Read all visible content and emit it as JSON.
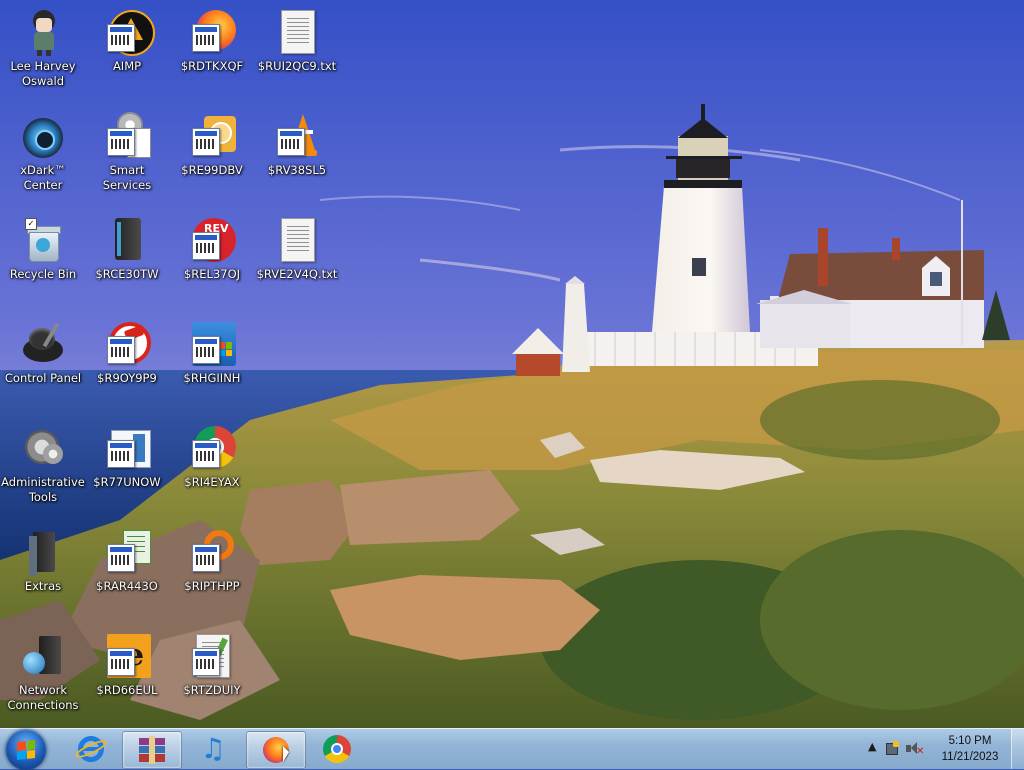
{
  "desktop": {
    "icons": [
      {
        "label": "Lee Harvey Oswald",
        "icon": "person-figure-icon"
      },
      {
        "label": "AIMP",
        "icon": "aimp-icon"
      },
      {
        "label": "$RDTKXQF",
        "icon": "firefox-shortcut-icon"
      },
      {
        "label": "$RUI2QC9.txt",
        "icon": "text-document-icon"
      },
      {
        "label": "xDark™ Center",
        "icon": "xdark-center-icon"
      },
      {
        "label": "Smart Services",
        "icon": "smart-services-icon"
      },
      {
        "label": "$RE99DBV",
        "icon": "shortcut-icon"
      },
      {
        "label": "$RV38SL5",
        "icon": "vlc-shortcut-icon"
      },
      {
        "label": "Recycle Bin",
        "icon": "recycle-bin-icon"
      },
      {
        "label": "$RCE30TW",
        "icon": "dark-device-icon"
      },
      {
        "label": "$REL37OJ",
        "icon": "rev-shortcut-icon"
      },
      {
        "label": "$RVE2V4Q.txt",
        "icon": "text-document-icon"
      },
      {
        "label": "Control Panel",
        "icon": "control-panel-icon"
      },
      {
        "label": "$R9OY9P9",
        "icon": "ccleaner-shortcut-icon"
      },
      {
        "label": "$RHGIINH",
        "icon": "installer-shortcut-icon"
      },
      {
        "label": "Administrative Tools",
        "icon": "administrative-tools-icon"
      },
      {
        "label": "$R77UNOW",
        "icon": "window-shortcut-icon"
      },
      {
        "label": "$RI4EYAX",
        "icon": "chrome-shortcut-icon"
      },
      {
        "label": "Extras",
        "icon": "extras-icon"
      },
      {
        "label": "$RAR443O",
        "icon": "spreadsheet-shortcut-icon"
      },
      {
        "label": "$RIPTHPP",
        "icon": "ring-shortcut-icon"
      },
      {
        "label": "Network Connections",
        "icon": "network-connections-icon"
      },
      {
        "label": "$RD66EUL",
        "icon": "editor-shortcut-icon"
      },
      {
        "label": "$RTZDUIY",
        "icon": "document-shortcut-icon"
      }
    ]
  },
  "taskbar": {
    "start_icon": "windows-start-orb-icon",
    "pinned": [
      {
        "name": "internet-explorer",
        "icon": "internet-explorer-icon"
      },
      {
        "name": "archive-app",
        "icon": "winrar-icon"
      },
      {
        "name": "music-player",
        "icon": "music-note-icon"
      },
      {
        "name": "firefox",
        "icon": "firefox-icon"
      },
      {
        "name": "chrome",
        "icon": "chrome-icon"
      }
    ],
    "tray": {
      "show_hidden": "▲",
      "clock_time": "5:10 PM",
      "clock_date": "11/21/2023"
    }
  },
  "colors": {
    "sky_top": "#3d59c9",
    "sea": "#1f3f8f",
    "grass": "#9a8a3a",
    "taskbar": "#93b4d6"
  }
}
